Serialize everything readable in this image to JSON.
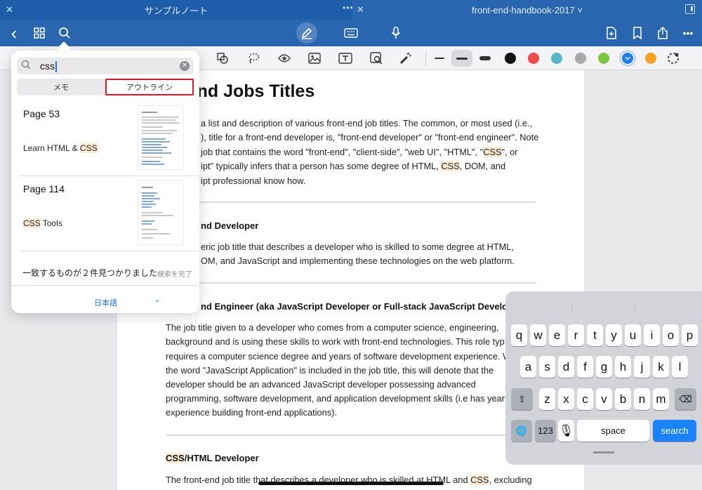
{
  "titlebars": {
    "left_title": "サンプルノート",
    "right_title": "front-end-handbook-2017 ˅",
    "left_close": "✕",
    "right_close": "✕",
    "dots": "•••"
  },
  "toolbar": {
    "back_icon": "‹",
    "grid_icon": "⊞",
    "search_icon": "⌕",
    "pen_icon": "✎",
    "keyboard_icon": "⌨",
    "mic_icon": "🎙",
    "add_page_icon": "⊞",
    "bookmark_icon": "⌑",
    "share_icon": "⇧",
    "more_icon": "•••"
  },
  "palette": {
    "colors": [
      "#111111",
      "#f04a4a",
      "#54b7c5",
      "#a9a9ab",
      "#7cc83c",
      "#1f7ef0",
      "#f5a423"
    ]
  },
  "search": {
    "query": "css",
    "clear_icon": "✕",
    "seg_memo": "メモ",
    "seg_outline": "アウトライン",
    "results": [
      {
        "page": "Page 53",
        "snippet_pre": "Learn HTML & ",
        "snippet_hl": "CSS",
        "snippet_post": ""
      },
      {
        "page": "Page 114",
        "snippet_pre": "",
        "snippet_hl": "CSS",
        "snippet_post": " Tools"
      }
    ],
    "found_text": "一致するものが２件見つかりました",
    "done_text": "検索を完了",
    "language": "日本語",
    "lang_chevron": "⌄"
  },
  "doc": {
    "title": "nt-End Jobs Titles",
    "intro_lines": [
      "a list and description of various front-end job titles. The common, or most used (i.e.,",
      "), title for a front-end developer is, \"front-end developer\" or \"front-end engineer\". Note",
      "job that contains the word \"front-end\", \"client-side\", \"web UI\", \"HTML\", \"",
      "ipt\" typically infers that a person has some degree of HTML, ",
      "ipt professional know how."
    ],
    "h_dev": "nd Developer",
    "dev_lines": [
      "eric job title that describes a developer who is skilled to some degree at HTML,",
      "OM, and JavaScript and implementing these technologies on the web platform."
    ],
    "h_eng": "nd Engineer (aka JavaScript Developer or Full-stack JavaScript Develop",
    "eng_lines": [
      "The job title given to a developer who comes from a computer science, engineering,",
      "background and is using these skills to work with front-end technologies. This role typ",
      "requires a computer science degree and years of software development experience. W",
      "the word \"JavaScript Application\" is included in the job title, this will denote that the",
      "developer should be an advanced JavaScript developer possessing advanced",
      "programming, software development, and application development skills (i.e has year",
      "experience building front-end applications)."
    ],
    "h_css_hl": "CSS",
    "h_css_rest": "/HTML Developer",
    "last_line_pre": "The front-end job title that describes a developer who is skilled at HTML and ",
    "last_line_post": ", excluding",
    "css": "CSS",
    "or": "\", or",
    "dom": ", DOM, and"
  },
  "keyboard": {
    "row1": [
      "q",
      "w",
      "e",
      "r",
      "t",
      "y",
      "u",
      "i",
      "o",
      "p"
    ],
    "row2": [
      "a",
      "s",
      "d",
      "f",
      "g",
      "h",
      "j",
      "k",
      "l"
    ],
    "row3": [
      "z",
      "x",
      "c",
      "v",
      "b",
      "n",
      "m"
    ],
    "shift": "⇧",
    "delete": "⌫",
    "globe": "🌐",
    "num": "123",
    "mic": "🎙",
    "space": "space",
    "search": "search"
  }
}
